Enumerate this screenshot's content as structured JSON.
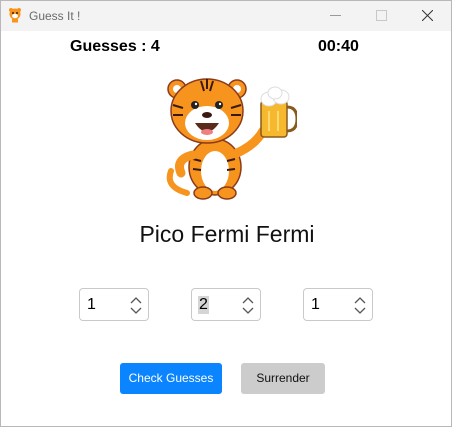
{
  "window": {
    "title": "Guess It !"
  },
  "header": {
    "guesses_text": "Guesses : 4",
    "timer_text": "00:40"
  },
  "result": {
    "text": "Pico Fermi Fermi"
  },
  "spinners": [
    {
      "value": "1"
    },
    {
      "value": "2"
    },
    {
      "value": "1"
    }
  ],
  "buttons": {
    "check_label": "Check Guesses",
    "surrender_label": "Surrender"
  },
  "colors": {
    "accent": "#0a84ff",
    "secondary_button": "#cccccc",
    "mascot_orange": "#f7941d"
  },
  "icons": {
    "app": "tiger-icon",
    "mascot": "tiger-with-beer-mascot"
  }
}
